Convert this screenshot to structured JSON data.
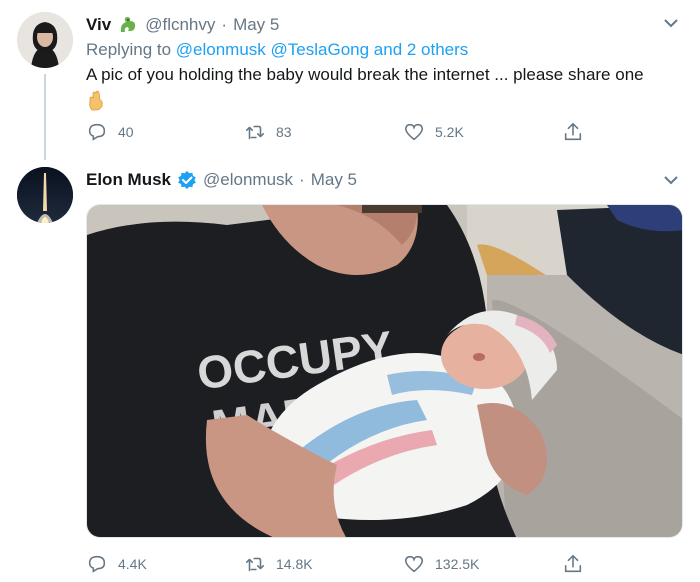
{
  "reply_tweet": {
    "name": "Viv",
    "handle": "@flcnhvy",
    "separator": "·",
    "date": "May 5",
    "replying_prefix": "Replying to ",
    "replying_links": [
      "@elonmusk",
      "@TeslaGong"
    ],
    "replying_and": " and ",
    "replying_others": "2 others",
    "text": "A pic of you holding the baby would break the internet ... please share one",
    "emoji_icon": "crossed-fingers-icon",
    "replies": "40",
    "retweets": "83",
    "likes": "5.2K"
  },
  "main_tweet": {
    "name": "Elon Musk",
    "verified_icon": "verified-badge-icon",
    "handle": "@elonmusk",
    "separator": "·",
    "date": "May 5",
    "shirt_text_line1": "OCCUPY",
    "shirt_text_line2": "MARS",
    "replies": "4.4K",
    "retweets": "14.8K",
    "likes": "132.5K"
  },
  "colors": {
    "link": "#1da1f2",
    "muted": "#657786",
    "text": "#14171a",
    "verified": "#1da1f2"
  }
}
